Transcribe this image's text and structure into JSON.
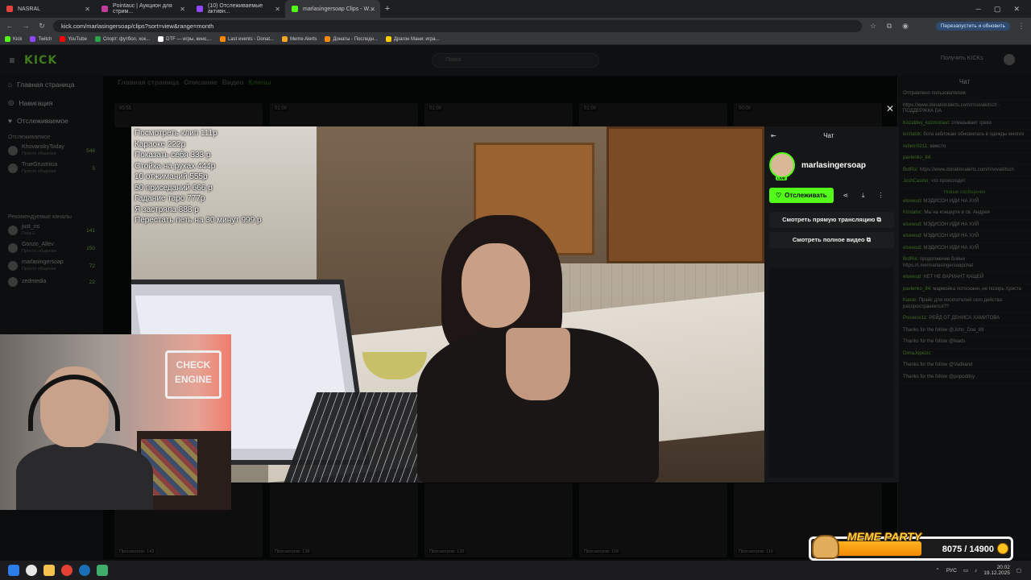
{
  "browser": {
    "tabs": [
      {
        "label": "NASRAL",
        "color": "#e0443a"
      },
      {
        "label": "Pointauc | Аукцион для стрим...",
        "color": "#c23c9b"
      },
      {
        "label": "(10) Отслеживаемые активн...",
        "color": "#9146ff"
      },
      {
        "label": "marlasingersoap Clips - W...",
        "color": "#53fc18"
      }
    ],
    "url": "kick.com/marlasingersoap/clips?sort=view&range=month",
    "relaunch_label": "Перезапустить и обновить",
    "bookmarks": [
      {
        "label": "Kick",
        "color": "#53fc18"
      },
      {
        "label": "Twitch",
        "color": "#9146ff"
      },
      {
        "label": "YouTube",
        "color": "#ff0000"
      },
      {
        "label": "Спорт: футбол, хок...",
        "color": "#2aa44a"
      },
      {
        "label": "DTF — игры, кино,...",
        "color": "#ffffff"
      },
      {
        "label": "Last events - Donat...",
        "color": "#ff8a00"
      },
      {
        "label": "Meme Alerts",
        "color": "#f5a623"
      },
      {
        "label": "Донаты - Последн...",
        "color": "#ff8a00"
      },
      {
        "label": "Драгон Мани: игра...",
        "color": "#ffcc00"
      }
    ]
  },
  "kick": {
    "logo": "KICK",
    "search_placeholder": "Поиск",
    "get_kicks": "Получить KICKs",
    "sidebar": {
      "nav": [
        {
          "label": "Главная страница",
          "icon": "home-icon",
          "glyph": "⌂"
        },
        {
          "label": "Навигация",
          "icon": "compass-icon",
          "glyph": "◎"
        },
        {
          "label": "Отслеживаемое",
          "icon": "heart-icon",
          "glyph": "♥"
        }
      ],
      "followed_header": "Отслеживаемое",
      "followed": [
        {
          "name": "KhovanskyToday",
          "sub": "Просто общение",
          "viewers": "546"
        },
        {
          "name": "TrueGrustnica",
          "sub": "Просто общение",
          "viewers": "5"
        }
      ],
      "recommended_header": "Рекомендуемые каналы",
      "recommended": [
        {
          "name": "just_ns",
          "sub": "Dota 2",
          "viewers": "141"
        },
        {
          "name": "Gonzo_Allev",
          "sub": "Просто общение",
          "viewers": "150"
        },
        {
          "name": "marlasingersoap",
          "sub": "Просто общение",
          "viewers": "72"
        },
        {
          "name": "zedmedia",
          "sub": "",
          "viewers": "22"
        }
      ]
    },
    "page_tabs": [
      "Главная страница",
      "Описание",
      "Видео",
      "Клипы"
    ],
    "thumbs_top": [
      "00:55",
      "01:00",
      "01:00",
      "01:00",
      "00:00"
    ],
    "thumbs_bottom": [
      "Просмотров: 143",
      "Просмотров: 138",
      "Просмотров: 120",
      "Просмотров: 118",
      "Просмотров: 116"
    ],
    "chat": {
      "header": "Чат",
      "messages": [
        {
          "user": "",
          "text": "Отправлено пользователем"
        },
        {
          "user": "",
          "text": "https://www.donationalerts.com/r/novakitsch · ПОДДЕРЖКА DA"
        },
        {
          "user": "Kozaldey_kozmonavt:",
          "text": "отмазывает грехи"
        },
        {
          "user": "kristalok:",
          "text": "бота заблокаю обновилась в одежды многих"
        },
        {
          "user": "rebern9211:",
          "text": "вместо"
        },
        {
          "user": "pavlenko_84:",
          "text": ""
        },
        {
          "user": "BotRix:",
          "text": "https://www.donationalerts.com/r/novakitsch"
        },
        {
          "user": "JoshCasino:",
          "text": "что происходит"
        },
        {
          "user": "elsewud:",
          "text": "МЭДИСОН ИДИ НА ХУЙ"
        },
        {
          "user": "Kristaloc:",
          "text": "Мы на концерте в св. Андрея"
        },
        {
          "user": "elsewud:",
          "text": "МЭДИСОН ИДИ НА ХУЙ"
        },
        {
          "user": "elsewud:",
          "text": "МЭДИСОН ИДИ НА ХУЙ"
        },
        {
          "user": "elsewud:",
          "text": "МЭДИСОН ИДИ НА ХУЙ"
        },
        {
          "user": "BotRix:",
          "text": "продолжение бойни https://t.me/marlasingersoapchat"
        },
        {
          "user": "elsewud:",
          "text": "НЕТ НЕ ВАРИАНТ КАЩЕЙ"
        },
        {
          "user": "pavlenko_84:",
          "text": "мармойка потосканн, не позорь Христа"
        },
        {
          "user": "Kaisle:",
          "text": "Прайс для посетителей сего действа распространяется??"
        },
        {
          "user": "Poiselox11:",
          "text": "РЕЙД ОТ ДЕНИСА ХАМИТОВА"
        },
        {
          "user": "",
          "text": "Thanks for the follow @John_Doe_89"
        },
        {
          "user": "",
          "text": "Thanks for the follow @leads"
        },
        {
          "user": "DimaJopezic:",
          "text": ""
        },
        {
          "user": "",
          "text": "Thanks for the follow @Vadkand"
        },
        {
          "user": "",
          "text": "Thanks for the follow @popoddsy"
        }
      ],
      "new_messages": "Новые сообщения"
    }
  },
  "modal": {
    "price_list": [
      "Посмотреть клип 111р",
      "Караоке 222р",
      "Показать себя 333 р",
      "Стойка на руках 444р",
      "10 отжиманий 555р",
      "50 приседаний 666 р",
      "Гадание таро 777р",
      "Я застряла 888 р",
      "Перестать петь на 30 минут 999 р"
    ],
    "side": {
      "header": "Чат",
      "channel": "marlasingersoap",
      "live_badge": "LIVE",
      "follow_label": "Отслеживать",
      "watch_live": "Смотреть прямую трансляцию",
      "watch_full": "Смотреть полное видео"
    }
  },
  "webcam": {
    "sign_text": "CHECK ENGINE"
  },
  "meme_party": {
    "title": "MEME PARTY",
    "current": 8075,
    "goal": 14900,
    "label": "8075 / 14900",
    "progress": 0.542
  },
  "taskbar": {
    "lang": "РУС",
    "time": "20:02",
    "date": "19.12.2025"
  }
}
